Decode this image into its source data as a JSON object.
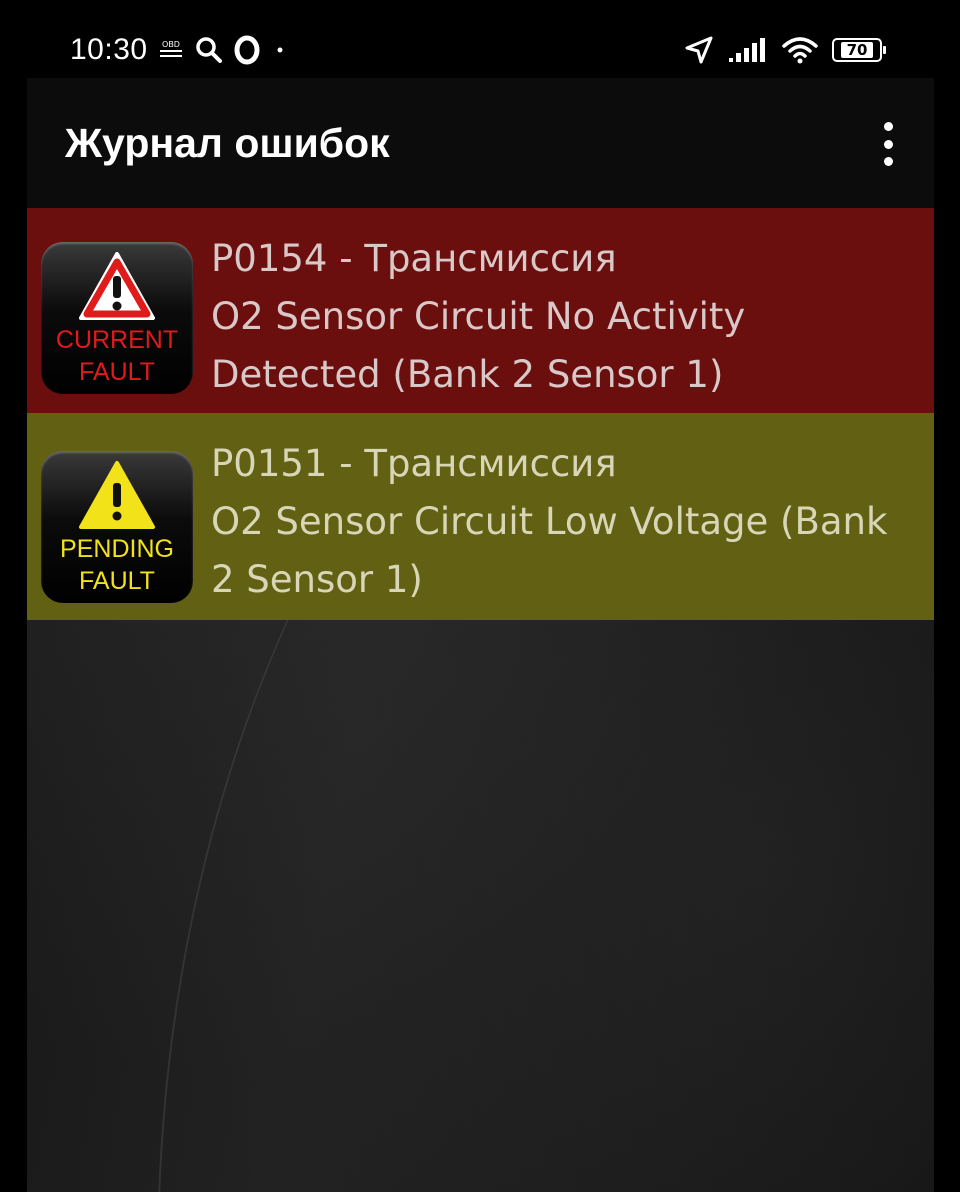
{
  "status_bar": {
    "time": "10:30",
    "obd_label": "OBD",
    "battery_level": "70",
    "icons": [
      "obd-icon",
      "search-icon",
      "opera-icon",
      "dot-icon",
      "location-arrow-icon",
      "signal-icon",
      "wifi-icon",
      "battery-icon"
    ]
  },
  "toolbar": {
    "title": "Журнал ошибок",
    "menu_icon": "overflow-menu-icon"
  },
  "faults": [
    {
      "code": "P0154 - Трансмиссия",
      "description": "O2 Sensor Circuit No Activity Detected (Bank 2 Sensor 1)",
      "badge_line1": "CURRENT",
      "badge_line2": "FAULT",
      "badge_icon": "warning-triangle-red-icon",
      "row_color": "#6a0e0e",
      "badge_text_color": "#e01b1b"
    },
    {
      "code": "P0151 - Трансмиссия",
      "description": "O2 Sensor Circuit Low Voltage (Bank 2 Sensor 1)",
      "badge_line1": "PENDING",
      "badge_line2": "FAULT",
      "badge_icon": "warning-triangle-yellow-icon",
      "row_color": "#626012",
      "badge_text_color": "#f1e21a"
    }
  ]
}
